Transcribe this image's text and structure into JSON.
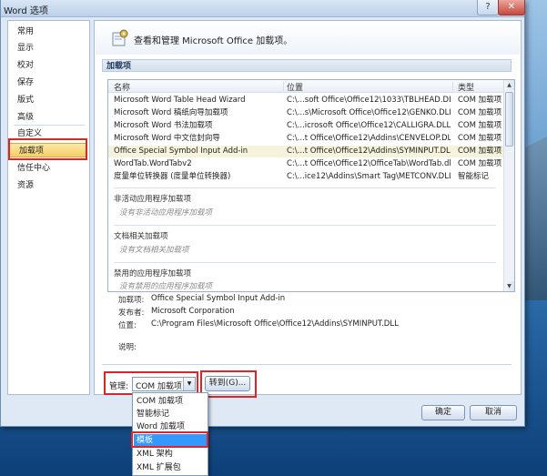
{
  "window": {
    "title": "Word 选项",
    "help_glyph": "?",
    "close_glyph": "✕"
  },
  "sidebar": {
    "items": [
      {
        "label": "常用"
      },
      {
        "label": "显示"
      },
      {
        "label": "校对"
      },
      {
        "label": "保存"
      },
      {
        "label": "版式"
      },
      {
        "label": "高级"
      },
      {
        "label": "自定义"
      },
      {
        "label": "加载项"
      },
      {
        "label": "信任中心"
      },
      {
        "label": "资源"
      }
    ],
    "selected": "加载项"
  },
  "main": {
    "header": "查看和管理 Microsoft Office 加载项。",
    "section_title": "加载项",
    "columns": {
      "name": "名称",
      "location": "位置",
      "type": "类型"
    },
    "active_addins": [
      {
        "name": "Microsoft Word Table Head Wizard",
        "location": "C:\\...soft Office\\Office12\\1033\\TBLHEAD.DLL",
        "type": "COM 加载项"
      },
      {
        "name": "Microsoft Word 稿纸向导加载项",
        "location": "C:\\...s\\Microsoft Office\\Office12\\GENKO.DLL",
        "type": "COM 加载项"
      },
      {
        "name": "Microsoft Word 书法加载项",
        "location": "C:\\...icrosoft Office\\Office12\\CALLIGRA.DLL",
        "type": "COM 加载项"
      },
      {
        "name": "Microsoft Word 中文信封向导",
        "location": "C:\\...t Office\\Office12\\Addins\\CENVELOP.DLL",
        "type": "COM 加载项"
      },
      {
        "name": "Office Special Symbol Input Add-in",
        "location": "C:\\...t Office\\Office12\\Addins\\SYMINPUT.DLL",
        "type": "COM 加载项"
      },
      {
        "name": "WordTab.WordTabv2",
        "location": "C:\\...t Office\\Office12\\OfficeTab\\WordTab.dll",
        "type": "COM 加载项"
      },
      {
        "name": "度量单位转换器 (度量单位转换器)",
        "location": "C:\\...ice12\\Addins\\Smart Tag\\METCONV.DLL",
        "type": "智能标记"
      }
    ],
    "groups": [
      {
        "title": "非活动应用程序加载项",
        "empty": "没有非活动应用程序加载项"
      },
      {
        "title": "文档相关加载项",
        "empty": "没有文档相关加载项"
      },
      {
        "title": "禁用的应用程序加载项",
        "empty": "没有禁用的应用程序加载项"
      }
    ],
    "details": {
      "addin_label": "加载项:",
      "addin_value": "Office Special Symbol Input Add-in",
      "publisher_label": "发布者:",
      "publisher_value": "Microsoft Corporation",
      "location_label": "位置:",
      "location_value": "C:\\Program Files\\Microsoft Office\\Office12\\Addins\\SYMINPUT.DLL",
      "desc_label": "说明:"
    },
    "manage": {
      "label": "管理:",
      "selected": "COM 加载项",
      "go_button": "转到(G)...",
      "options": [
        "COM 加载项",
        "智能标记",
        "Word 加载项",
        "模板",
        "XML 架构",
        "XML 扩展包"
      ],
      "highlighted_option": "模板"
    }
  },
  "footer": {
    "ok": "确定",
    "cancel": "取消"
  },
  "colors": {
    "highlight_red": "#e02525",
    "selection_blue": "#3399ff",
    "nav_selected": "#f5cf62"
  }
}
